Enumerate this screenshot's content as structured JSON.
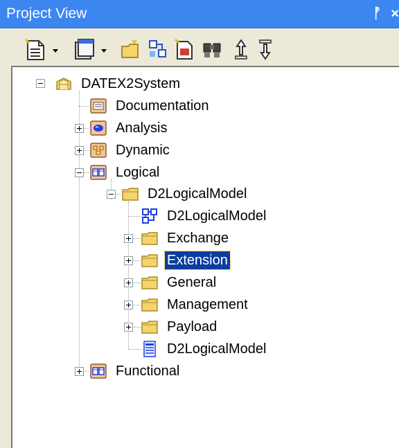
{
  "window": {
    "title": "Project View",
    "pin_glyph": "ᚡ",
    "close_glyph": "×"
  },
  "toolbar": {
    "buttons": [
      {
        "name": "new-element-icon"
      },
      {
        "name": "new-diagram-icon"
      },
      {
        "name": "new-package-icon"
      },
      {
        "name": "new-view-icon"
      },
      {
        "name": "add-element-icon"
      },
      {
        "name": "find-icon"
      },
      {
        "name": "move-up-icon"
      },
      {
        "name": "move-down-icon"
      }
    ]
  },
  "tree": {
    "root": {
      "label": "DATEX2System",
      "icon": "project-icon"
    },
    "nodes": [
      {
        "label": "Documentation",
        "icon": "documentation-view-icon"
      },
      {
        "label": "Analysis",
        "icon": "analysis-view-icon"
      },
      {
        "label": "Dynamic",
        "icon": "dynamic-view-icon"
      },
      {
        "label": "Logical",
        "icon": "logical-view-icon"
      },
      {
        "label": "D2LogicalModel",
        "icon": "package-icon"
      },
      {
        "label": "D2LogicalModel",
        "icon": "class-diagram-icon"
      },
      {
        "label": "Exchange",
        "icon": "package-icon"
      },
      {
        "label": "Extension",
        "icon": "package-icon",
        "selected": true
      },
      {
        "label": "General",
        "icon": "package-icon"
      },
      {
        "label": "Management",
        "icon": "package-icon"
      },
      {
        "label": "Payload",
        "icon": "package-icon"
      },
      {
        "label": "D2LogicalModel",
        "icon": "model-document-icon"
      },
      {
        "label": "Functional",
        "icon": "functional-view-icon"
      }
    ]
  },
  "colors": {
    "title_bar": "#3c86f0",
    "selection": "#0a3d9f",
    "folder": "#f5d56b"
  }
}
